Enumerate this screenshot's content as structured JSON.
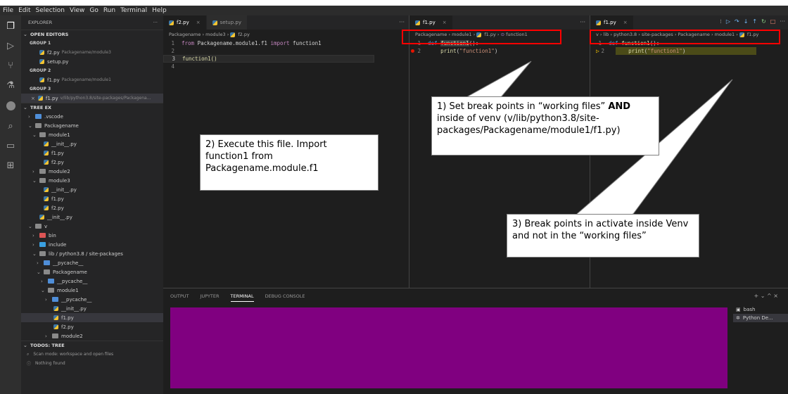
{
  "menu": [
    "File",
    "Edit",
    "Selection",
    "View",
    "Go",
    "Run",
    "Terminal",
    "Help"
  ],
  "activity_icons": [
    "files-icon",
    "run-debug-icon",
    "source-control-icon",
    "testing-icon",
    "remote-icon",
    "search-icon",
    "remote-explorer-icon",
    "extensions-icon"
  ],
  "sidebar": {
    "title": "EXPLORER",
    "more": "···",
    "open_editors": {
      "header": "OPEN EDITORS",
      "groups": [
        {
          "label": "GROUP 1",
          "files": [
            {
              "name": "f2.py",
              "path": "Packagename/module3"
            },
            {
              "name": "setup.py",
              "path": ""
            }
          ]
        },
        {
          "label": "GROUP 2",
          "files": [
            {
              "name": "f1.py",
              "path": "Packagename/module1"
            }
          ]
        },
        {
          "label": "GROUP 3",
          "files": [
            {
              "name": "f1.py",
              "path": "v/lib/python3.8/site-packages/Packagena..."
            }
          ]
        }
      ]
    },
    "tree_header": "TREE EX",
    "tree": [
      ".vscode",
      "Packagename",
      "module1",
      "__init__.py",
      "f1.py",
      "f2.py",
      "module2",
      "module3",
      "__init__.py",
      "f1.py",
      "f2.py",
      "__init__.py",
      "v",
      "bin",
      "include",
      "lib / python3.8 / site-packages",
      "__pycache__",
      "Packagename",
      "__pycache__",
      "module1",
      "__pycache__",
      "__init__.py",
      "f1.py",
      "f2.py",
      "module2"
    ],
    "todos_header": "TODOS: TREE",
    "todos": [
      "Scan mode: workspace and open files",
      "Nothing found"
    ]
  },
  "pane1": {
    "tabs": [
      {
        "label": "f2.py",
        "close": "×"
      },
      {
        "label": "setup.py",
        "close": ""
      }
    ],
    "more": "···",
    "crumbs": [
      "Packagename",
      "module3",
      "f2.py"
    ],
    "lines": {
      "l1_kw": "from",
      "l1_mod": "Packagename.module1.f1",
      "l1_kw2": "import",
      "l1_name": "function1",
      "l3": "function1()"
    },
    "line_numbers": [
      "1",
      "2",
      "3",
      "4"
    ]
  },
  "pane2": {
    "tab": "f1.py",
    "close": "×",
    "more": "···",
    "crumbs": [
      "Packagename",
      "module1",
      "f1.py",
      "function1"
    ],
    "line_numbers": [
      "1",
      "2"
    ],
    "lines": {
      "def": "def",
      "fname": "function1",
      "sig": "():",
      "print": "print",
      "arg": "\"function1\""
    }
  },
  "pane3": {
    "tab": "f1.py",
    "close": "×",
    "crumbs": [
      "v",
      "lib",
      "python3.8",
      "site-packages",
      "Packagename",
      "module1",
      "f1.py"
    ],
    "debug_toolbar": [
      "continue-icon",
      "step-over-icon",
      "step-into-icon",
      "step-out-icon",
      "restart-icon",
      "stop-icon",
      "more-icon"
    ],
    "line_numbers": [
      "1",
      "2"
    ],
    "lines": {
      "def": "def",
      "fname": "function1",
      "sig": "():",
      "print": "print",
      "arg": "\"function1\""
    }
  },
  "panel": {
    "tabs": [
      "OUTPUT",
      "JUPYTER",
      "TERMINAL",
      "DEBUG CONSOLE"
    ],
    "active_tab": "TERMINAL",
    "controls": "+ ⌄ ^ ×",
    "terminals": [
      "bash",
      "Python De..."
    ]
  },
  "callouts": {
    "one_a": "1) Set break points in “working files” ",
    "one_b": "AND",
    "one_c": " inside of venv (v/lib/python3.8/site-packages/Packagename/module1/f1.py)",
    "two": "2) Execute this file. Import function1 from Packagename.module.f1",
    "three": "3) Break points in activate inside Venv and not in the “working files”"
  },
  "colors": {
    "annotation_red": "#ff0000",
    "terminal_bg": "#800080",
    "breakpoint": "#e51400"
  }
}
